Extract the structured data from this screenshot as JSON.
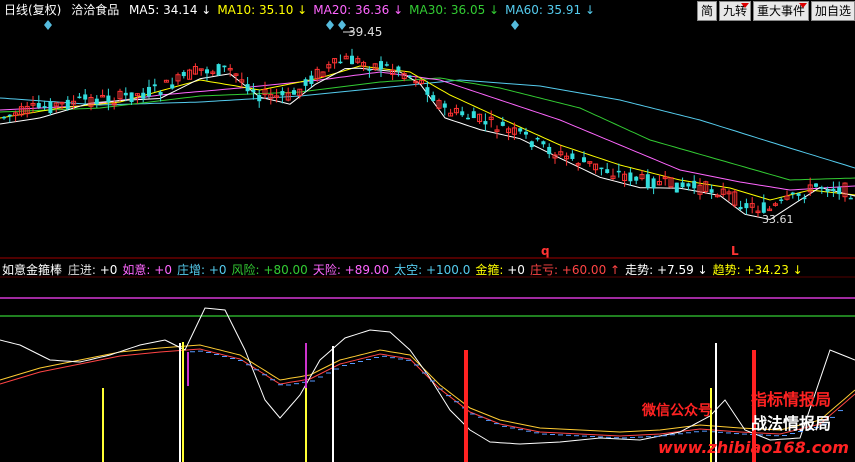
{
  "header": {
    "period": "日线(复权)",
    "stock": "洽洽食品",
    "ma": [
      {
        "label": "MA5:",
        "value": "34.14",
        "arrow": "↓",
        "color": "#ffffff"
      },
      {
        "label": "MA10:",
        "value": "35.10",
        "arrow": "↓",
        "color": "#ffff00"
      },
      {
        "label": "MA20:",
        "value": "36.36",
        "arrow": "↓",
        "color": "#ff66ff"
      },
      {
        "label": "MA30:",
        "value": "36.05",
        "arrow": "↓",
        "color": "#33cc33"
      },
      {
        "label": "MA60:",
        "value": "35.91",
        "arrow": "↓",
        "color": "#55ccee"
      }
    ]
  },
  "toolbar": {
    "simple": "简",
    "nine": "九转",
    "events": "重大事件",
    "watch": "加自选"
  },
  "price_labels": {
    "high": "39.45",
    "low": "33.61"
  },
  "marks": {
    "q": "q",
    "l": "L"
  },
  "indicator": {
    "name": "如意金箍棒",
    "items": [
      {
        "label": "庄进:",
        "value": "+0",
        "label_color": "#dddddd",
        "value_color": "#ffffff"
      },
      {
        "label": "如意:",
        "value": "+0",
        "label_color": "#ff66ff",
        "value_color": "#ff66ff"
      },
      {
        "label": "庄增:",
        "value": "+0",
        "label_color": "#55ccee",
        "value_color": "#55ccee"
      },
      {
        "label": "风险:",
        "value": "+80.00",
        "label_color": "#33cc33",
        "value_color": "#33cc33"
      },
      {
        "label": "天险:",
        "value": "+89.00",
        "label_color": "#ff66ff",
        "value_color": "#ff66ff"
      },
      {
        "label": "太空:",
        "value": "+100.0",
        "label_color": "#55ccee",
        "value_color": "#55ccee"
      },
      {
        "label": "金箍:",
        "value": "+0",
        "label_color": "#ffff00",
        "value_color": "#ffffff"
      },
      {
        "label": "庄亏:",
        "value": "+60.00",
        "label_color": "#ff4444",
        "value_color": "#ff4444",
        "arrow": "↑"
      },
      {
        "label": "走势:",
        "value": "+7.59",
        "label_color": "#ffffff",
        "value_color": "#ffffff",
        "arrow": "↓"
      },
      {
        "label": "趋势:",
        "value": "+34.23",
        "label_color": "#ffff00",
        "value_color": "#ffff00",
        "arrow": "↓"
      }
    ]
  },
  "watermark": {
    "line1": "指标情报局",
    "line2": "战法情报局",
    "wechat": "微信公众号",
    "url": "www.zhibiao168.com"
  },
  "colors": {
    "up": "#ff3333",
    "down": "#33dddd",
    "ma5": "#ffffff",
    "ma10": "#ffff00",
    "ma20": "#ff66ff",
    "ma30": "#33cc33",
    "ma60": "#55ccee"
  }
}
